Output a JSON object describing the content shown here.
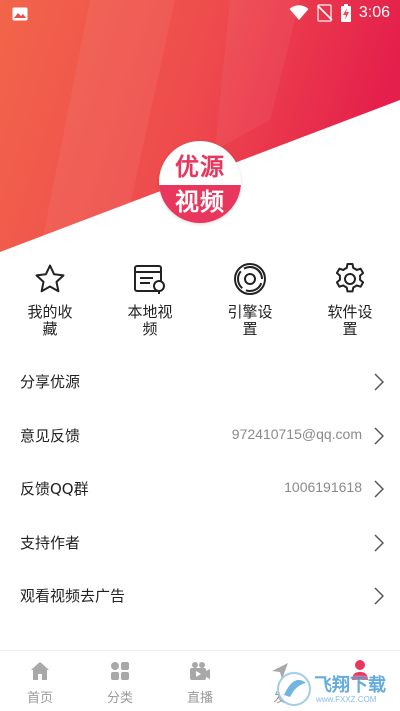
{
  "status_bar": {
    "time": "3:06",
    "icons": [
      "image-icon",
      "wifi-icon",
      "no-signal-icon",
      "battery-charging-icon"
    ]
  },
  "profile": {
    "logo_line1": "优源",
    "logo_line2": "视频",
    "brand_color": "#e8365d"
  },
  "quick_actions": [
    {
      "label": "我的收藏",
      "icon": "star-icon"
    },
    {
      "label": "本地视频",
      "icon": "local-video-icon"
    },
    {
      "label": "引擎设置",
      "icon": "engine-icon"
    },
    {
      "label": "软件设置",
      "icon": "gear-icon"
    }
  ],
  "menu": [
    {
      "title": "分享优源",
      "value": ""
    },
    {
      "title": "意见反馈",
      "value": "972410715@qq.com"
    },
    {
      "title": "反馈QQ群",
      "value": "1006191618"
    },
    {
      "title": "支持作者",
      "value": ""
    },
    {
      "title": "观看视频去广告",
      "value": ""
    }
  ],
  "tabbar": [
    {
      "label": "首页",
      "icon": "home-icon"
    },
    {
      "label": "分类",
      "icon": "category-icon"
    },
    {
      "label": "直播",
      "icon": "live-icon"
    },
    {
      "label": "发",
      "icon": "discover-icon"
    },
    {
      "label": "",
      "icon": "profile-icon"
    }
  ],
  "watermark": {
    "text": "飞翔下载",
    "url": "www.FXXZ.COM"
  }
}
